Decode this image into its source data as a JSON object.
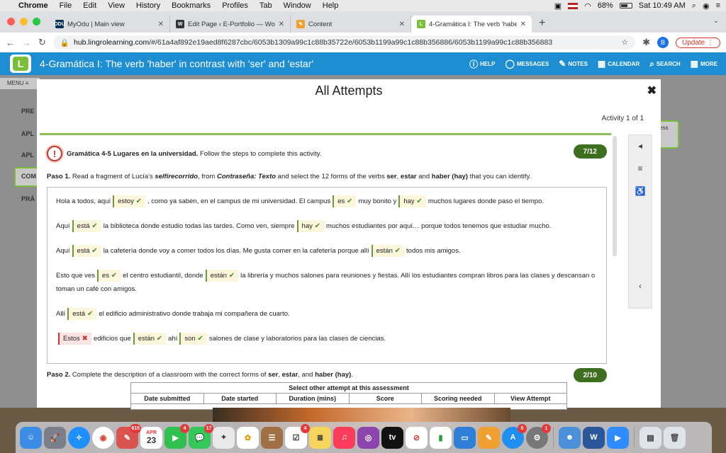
{
  "menubar": {
    "app": "Chrome",
    "items": [
      "File",
      "Edit",
      "View",
      "History",
      "Bookmarks",
      "Profiles",
      "Tab",
      "Window",
      "Help"
    ],
    "battery": "68%",
    "clock": "Sat 10:49 AM"
  },
  "browser": {
    "tabs": [
      {
        "label": "MyOdu | Main view",
        "favicon": "ODU",
        "color": "#003057"
      },
      {
        "label": "Edit Page ‹ E-Portfolio — Word",
        "favicon": "W",
        "color": "#333333"
      },
      {
        "label": "Content",
        "favicon": "✎",
        "color": "#f0a030"
      },
      {
        "label": "4-Gramática I: The verb 'haber'",
        "favicon": "L",
        "color": "#7cbd3a"
      }
    ],
    "url_host": "hub.lingrolearning.com",
    "url_path": "/#/61a4af892e19aed8f6287cbc/6053b1309a99c1c88b35722e/6053b1199a99c1c88b356886/6053b1199a99c1c88b356883",
    "profile": "B",
    "update_label": "Update"
  },
  "app": {
    "logo": "L",
    "title": "4-Gramática I: The verb 'haber' in contrast with 'ser' and 'estar'",
    "nav": {
      "help": "HELP",
      "messages": "MESSAGES",
      "notes": "NOTES",
      "calendar": "CALENDAR",
      "search": "SEARCH",
      "more": "MORE"
    },
    "menu_label": "MENU",
    "sidebar": [
      "PRE",
      "APL",
      "APL",
      "COM",
      "PRÁ"
    ],
    "right_tag": "ess"
  },
  "modal": {
    "title": "All Attempts",
    "activity": "Activity 1 of 1",
    "question_title": "Gramática 4-5 Lugares en la universidad.",
    "question_instructions": "Follow the steps to complete this activity.",
    "score1": "7/12",
    "paso1": {
      "label": "Paso 1.",
      "a": "Read a fragment of Lucía's ",
      "b": "selfirecorrido",
      "c": ", from ",
      "d": "Contraseña: Texto",
      "e": " and select the 12 forms of the verbs ",
      "f": "ser",
      "g": ", ",
      "h": "estar",
      "i": " and ",
      "j": "haber (hay)",
      "k": " that you can identify."
    },
    "p1": {
      "t0": "Hola a todos, aquí",
      "w1": "estoy",
      "t1": ", como ya saben, en el campus de mi universidad. El campus",
      "w2": "es",
      "t2": "muy bonito y",
      "w3": "hay",
      "t3": "muchos lugares donde paso el tiempo."
    },
    "p2": {
      "t0": "Aquí",
      "w1": "está",
      "t1": "la biblioteca donde estudio todas las tardes. Como ven, siempre",
      "w2": "hay",
      "t2": "muchos estudiantes por aquí… porque todos tenemos que estudiar mucho."
    },
    "p3": {
      "t0": "Aquí",
      "w1": "está",
      "t1": "la cafetería donde voy a comer todos los días. Me gusta comer en la cafetería porque allí",
      "w2": "están",
      "t2": "todos mis amigos."
    },
    "p4": {
      "t0": "Esto que ves",
      "w1": "es",
      "t1": "el centro estudiantil, donde",
      "w2": "están",
      "t2": "la librería y muchos salones para reuniones y fiestas. Allí los estudiantes compran libros para las clases y descansan o toman un café con amigos."
    },
    "p5": {
      "t0": "Allí",
      "w1": "está",
      "t1": "el edificio administrativo donde trabaja mi compañera de cuarto."
    },
    "p6": {
      "w0": "Estos",
      "t0": "edificios que",
      "w1": "están",
      "t1": "ahí",
      "w2": "son",
      "t2": "salones de clase y laboratorios para las clases de ciencias."
    },
    "paso2": {
      "label": "Paso 2.",
      "a": "Complete the description of a classroom with the correct forms of ",
      "b": "ser",
      "c": ", ",
      "d": "estar",
      "e": ", and ",
      "f": "haber (hay)",
      "g": "."
    },
    "score2": "2/10",
    "attempts": {
      "caption": "Select other attempt at this assessment",
      "headers": [
        "Date submitted",
        "Date started",
        "Duration (mins)",
        "Score",
        "Scoring needed",
        "View Attempt"
      ]
    }
  },
  "dock": {
    "badges": {
      "news": "615",
      "calendar_month": "APR",
      "calendar_day": "23",
      "facetime": "4",
      "messages": "17",
      "reminders": "4",
      "appstore": "5",
      "sysprefs": "1"
    }
  }
}
